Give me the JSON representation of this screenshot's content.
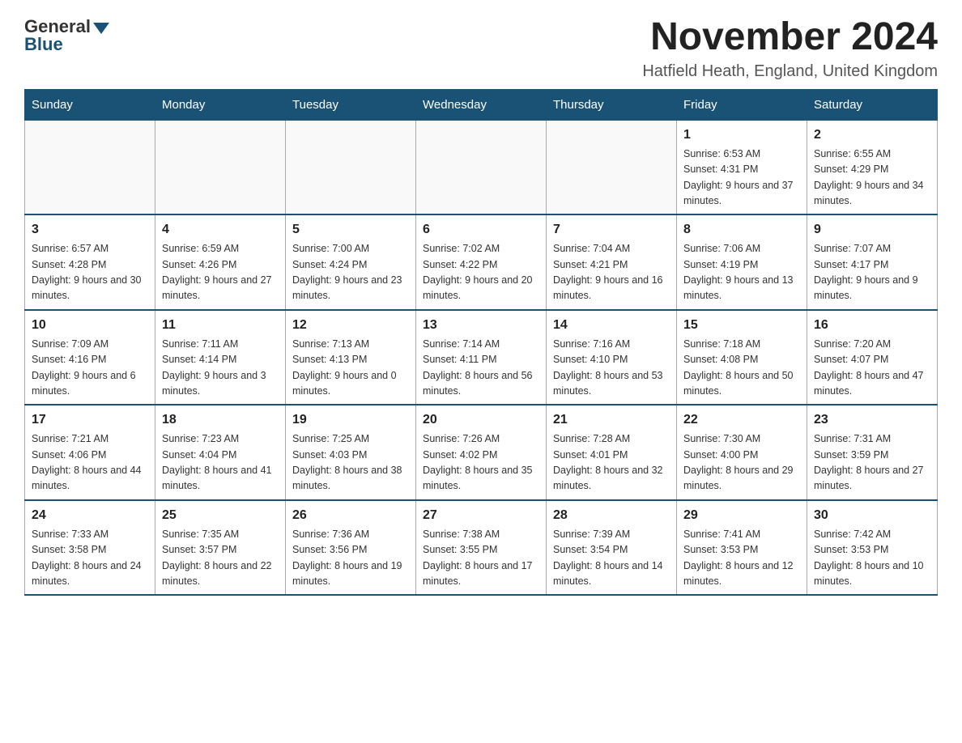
{
  "logo": {
    "general": "General",
    "blue": "Blue"
  },
  "title": "November 2024",
  "location": "Hatfield Heath, England, United Kingdom",
  "days_of_week": [
    "Sunday",
    "Monday",
    "Tuesday",
    "Wednesday",
    "Thursday",
    "Friday",
    "Saturday"
  ],
  "weeks": [
    [
      {
        "day": "",
        "sun": "",
        "set": "",
        "daylight": ""
      },
      {
        "day": "",
        "sun": "",
        "set": "",
        "daylight": ""
      },
      {
        "day": "",
        "sun": "",
        "set": "",
        "daylight": ""
      },
      {
        "day": "",
        "sun": "",
        "set": "",
        "daylight": ""
      },
      {
        "day": "",
        "sun": "",
        "set": "",
        "daylight": ""
      },
      {
        "day": "1",
        "sun": "Sunrise: 6:53 AM",
        "set": "Sunset: 4:31 PM",
        "daylight": "Daylight: 9 hours and 37 minutes."
      },
      {
        "day": "2",
        "sun": "Sunrise: 6:55 AM",
        "set": "Sunset: 4:29 PM",
        "daylight": "Daylight: 9 hours and 34 minutes."
      }
    ],
    [
      {
        "day": "3",
        "sun": "Sunrise: 6:57 AM",
        "set": "Sunset: 4:28 PM",
        "daylight": "Daylight: 9 hours and 30 minutes."
      },
      {
        "day": "4",
        "sun": "Sunrise: 6:59 AM",
        "set": "Sunset: 4:26 PM",
        "daylight": "Daylight: 9 hours and 27 minutes."
      },
      {
        "day": "5",
        "sun": "Sunrise: 7:00 AM",
        "set": "Sunset: 4:24 PM",
        "daylight": "Daylight: 9 hours and 23 minutes."
      },
      {
        "day": "6",
        "sun": "Sunrise: 7:02 AM",
        "set": "Sunset: 4:22 PM",
        "daylight": "Daylight: 9 hours and 20 minutes."
      },
      {
        "day": "7",
        "sun": "Sunrise: 7:04 AM",
        "set": "Sunset: 4:21 PM",
        "daylight": "Daylight: 9 hours and 16 minutes."
      },
      {
        "day": "8",
        "sun": "Sunrise: 7:06 AM",
        "set": "Sunset: 4:19 PM",
        "daylight": "Daylight: 9 hours and 13 minutes."
      },
      {
        "day": "9",
        "sun": "Sunrise: 7:07 AM",
        "set": "Sunset: 4:17 PM",
        "daylight": "Daylight: 9 hours and 9 minutes."
      }
    ],
    [
      {
        "day": "10",
        "sun": "Sunrise: 7:09 AM",
        "set": "Sunset: 4:16 PM",
        "daylight": "Daylight: 9 hours and 6 minutes."
      },
      {
        "day": "11",
        "sun": "Sunrise: 7:11 AM",
        "set": "Sunset: 4:14 PM",
        "daylight": "Daylight: 9 hours and 3 minutes."
      },
      {
        "day": "12",
        "sun": "Sunrise: 7:13 AM",
        "set": "Sunset: 4:13 PM",
        "daylight": "Daylight: 9 hours and 0 minutes."
      },
      {
        "day": "13",
        "sun": "Sunrise: 7:14 AM",
        "set": "Sunset: 4:11 PM",
        "daylight": "Daylight: 8 hours and 56 minutes."
      },
      {
        "day": "14",
        "sun": "Sunrise: 7:16 AM",
        "set": "Sunset: 4:10 PM",
        "daylight": "Daylight: 8 hours and 53 minutes."
      },
      {
        "day": "15",
        "sun": "Sunrise: 7:18 AM",
        "set": "Sunset: 4:08 PM",
        "daylight": "Daylight: 8 hours and 50 minutes."
      },
      {
        "day": "16",
        "sun": "Sunrise: 7:20 AM",
        "set": "Sunset: 4:07 PM",
        "daylight": "Daylight: 8 hours and 47 minutes."
      }
    ],
    [
      {
        "day": "17",
        "sun": "Sunrise: 7:21 AM",
        "set": "Sunset: 4:06 PM",
        "daylight": "Daylight: 8 hours and 44 minutes."
      },
      {
        "day": "18",
        "sun": "Sunrise: 7:23 AM",
        "set": "Sunset: 4:04 PM",
        "daylight": "Daylight: 8 hours and 41 minutes."
      },
      {
        "day": "19",
        "sun": "Sunrise: 7:25 AM",
        "set": "Sunset: 4:03 PM",
        "daylight": "Daylight: 8 hours and 38 minutes."
      },
      {
        "day": "20",
        "sun": "Sunrise: 7:26 AM",
        "set": "Sunset: 4:02 PM",
        "daylight": "Daylight: 8 hours and 35 minutes."
      },
      {
        "day": "21",
        "sun": "Sunrise: 7:28 AM",
        "set": "Sunset: 4:01 PM",
        "daylight": "Daylight: 8 hours and 32 minutes."
      },
      {
        "day": "22",
        "sun": "Sunrise: 7:30 AM",
        "set": "Sunset: 4:00 PM",
        "daylight": "Daylight: 8 hours and 29 minutes."
      },
      {
        "day": "23",
        "sun": "Sunrise: 7:31 AM",
        "set": "Sunset: 3:59 PM",
        "daylight": "Daylight: 8 hours and 27 minutes."
      }
    ],
    [
      {
        "day": "24",
        "sun": "Sunrise: 7:33 AM",
        "set": "Sunset: 3:58 PM",
        "daylight": "Daylight: 8 hours and 24 minutes."
      },
      {
        "day": "25",
        "sun": "Sunrise: 7:35 AM",
        "set": "Sunset: 3:57 PM",
        "daylight": "Daylight: 8 hours and 22 minutes."
      },
      {
        "day": "26",
        "sun": "Sunrise: 7:36 AM",
        "set": "Sunset: 3:56 PM",
        "daylight": "Daylight: 8 hours and 19 minutes."
      },
      {
        "day": "27",
        "sun": "Sunrise: 7:38 AM",
        "set": "Sunset: 3:55 PM",
        "daylight": "Daylight: 8 hours and 17 minutes."
      },
      {
        "day": "28",
        "sun": "Sunrise: 7:39 AM",
        "set": "Sunset: 3:54 PM",
        "daylight": "Daylight: 8 hours and 14 minutes."
      },
      {
        "day": "29",
        "sun": "Sunrise: 7:41 AM",
        "set": "Sunset: 3:53 PM",
        "daylight": "Daylight: 8 hours and 12 minutes."
      },
      {
        "day": "30",
        "sun": "Sunrise: 7:42 AM",
        "set": "Sunset: 3:53 PM",
        "daylight": "Daylight: 8 hours and 10 minutes."
      }
    ]
  ]
}
